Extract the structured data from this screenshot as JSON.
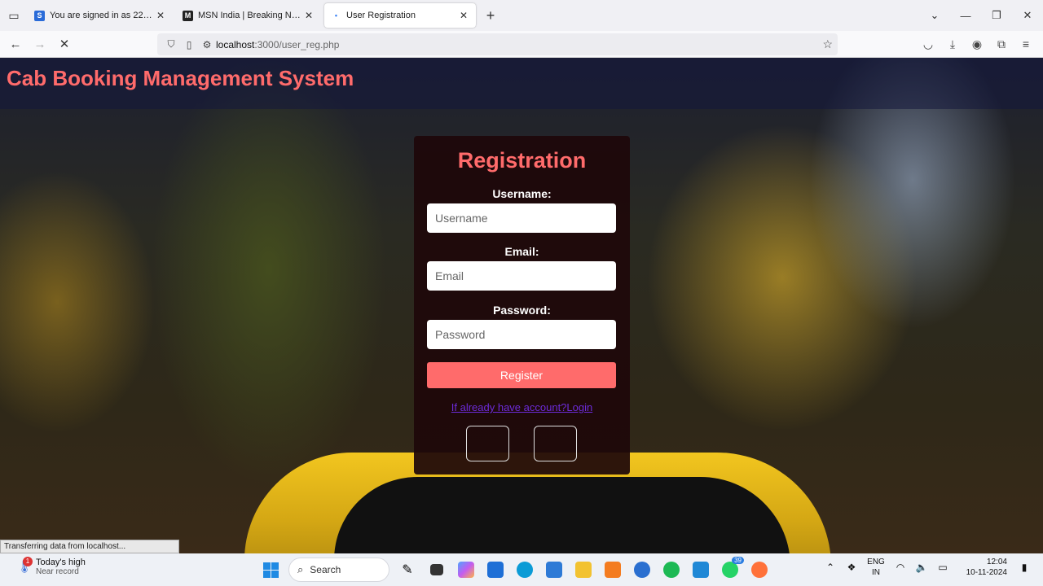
{
  "browser": {
    "tabs": [
      {
        "title": "You are signed in as 22bt067",
        "favicon": "S",
        "favicon_color": "#2a6bd8",
        "active": false
      },
      {
        "title": "MSN India | Breaking News, Ent",
        "favicon": "M",
        "favicon_color": "#222222",
        "active": false
      },
      {
        "title": "User Registration",
        "favicon": "•",
        "favicon_color": "#3b82f6",
        "active": true
      }
    ],
    "url_host": "localhost",
    "url_path": ":3000/user_reg.php"
  },
  "page": {
    "site_title": "Cab Booking Management System",
    "form": {
      "heading": "Registration",
      "username_label": "Username:",
      "username_placeholder": "Username",
      "email_label": "Email:",
      "email_placeholder": "Email",
      "password_label": "Password:",
      "password_placeholder": "Password",
      "register_button": "Register",
      "login_link": "If already have account?Login"
    },
    "status_text": "Transferring data from localhost..."
  },
  "taskbar": {
    "weather_title": "Today's high",
    "weather_sub": "Near record",
    "weather_badge": "1",
    "search_placeholder": "Search",
    "whatsapp_badge": "39",
    "lang_top": "ENG",
    "lang_bottom": "IN",
    "time": "12:04",
    "date": "10-11-2024"
  },
  "colors": {
    "accent": "#ff6b6b",
    "link": "#6c2bd9"
  }
}
